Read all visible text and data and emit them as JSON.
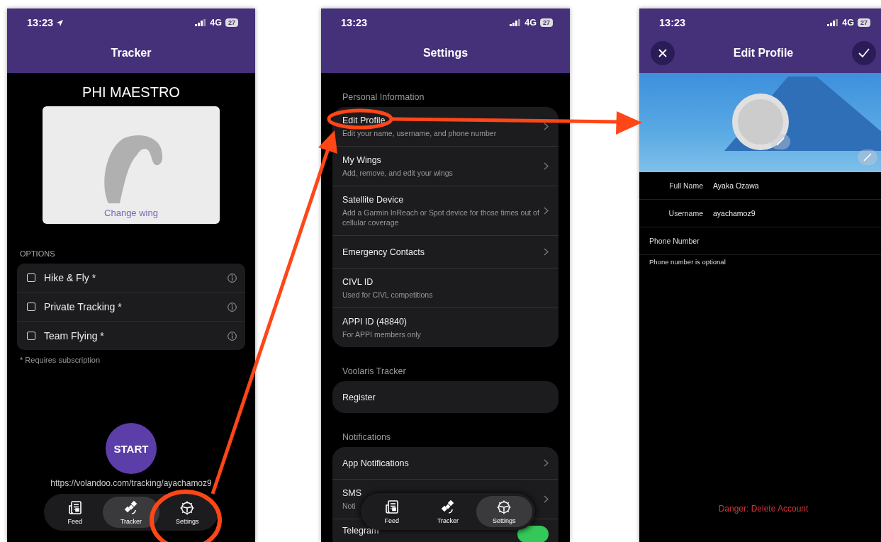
{
  "tracker_screen": {
    "status": {
      "time": "13:23",
      "location": true,
      "network": "4G",
      "battery": "27"
    },
    "title": "Tracker",
    "wing_name": "PHI MAESTRO",
    "change_wing": "Change wing",
    "options_header": "OPTIONS",
    "options": [
      {
        "label": "Hike & Fly *",
        "checked": false
      },
      {
        "label": "Private Tracking *",
        "checked": false
      },
      {
        "label": "Team Flying *",
        "checked": false
      }
    ],
    "footnote": "* Requires subscription",
    "start": "START",
    "url": "https://volandoo.com/tracking/ayachamoz9",
    "tabs": [
      {
        "label": "Feed",
        "selected": false
      },
      {
        "label": "Tracker",
        "selected": true
      },
      {
        "label": "Settings",
        "selected": false
      }
    ]
  },
  "settings_screen": {
    "status": {
      "time": "13:23",
      "location": false,
      "network": "4G",
      "battery": "27"
    },
    "title": "Settings",
    "sections": [
      {
        "header": "Personal Information",
        "items": [
          {
            "kind": "link",
            "title": "Edit Profile",
            "subtitle": "Edit your name, username, and phone number"
          },
          {
            "kind": "link",
            "title": "My Wings",
            "subtitle": "Add, remove, and edit your wings"
          },
          {
            "kind": "link",
            "title": "Satellite Device",
            "subtitle": "Add a Garmin InReach or Spot device for those times out of cellular coverage"
          },
          {
            "kind": "link",
            "title": "Emergency Contacts"
          },
          {
            "kind": "action",
            "title": "CIVL ID",
            "subtitle": "Used for CIVL competitions"
          },
          {
            "kind": "action",
            "title": "APPI ID (48840)",
            "subtitle": "For APPI members only"
          }
        ]
      },
      {
        "header": "Voolaris Tracker",
        "items": [
          {
            "kind": "action",
            "title": "Register"
          }
        ]
      },
      {
        "header": "Notifications",
        "items": [
          {
            "kind": "link",
            "title": "App Notifications"
          },
          {
            "kind": "link",
            "title": "SMS",
            "subtitle": "Noti"
          },
          {
            "kind": "toggle",
            "title": "Telegram",
            "on": true
          }
        ]
      }
    ],
    "tabs": [
      {
        "label": "Feed",
        "selected": false
      },
      {
        "label": "Tracker",
        "selected": false
      },
      {
        "label": "Settings",
        "selected": true
      }
    ]
  },
  "profile_screen": {
    "status": {
      "time": "13:23",
      "location": false,
      "network": "4G",
      "battery": "27"
    },
    "title": "Edit Profile",
    "fields": [
      {
        "label": "Full Name",
        "value": "Ayaka Ozawa"
      },
      {
        "label": "Username",
        "value": "ayachamoz9"
      },
      {
        "label": "Phone Number"
      }
    ],
    "helper": "Phone number is optional",
    "danger": "Danger: Delete Account"
  }
}
